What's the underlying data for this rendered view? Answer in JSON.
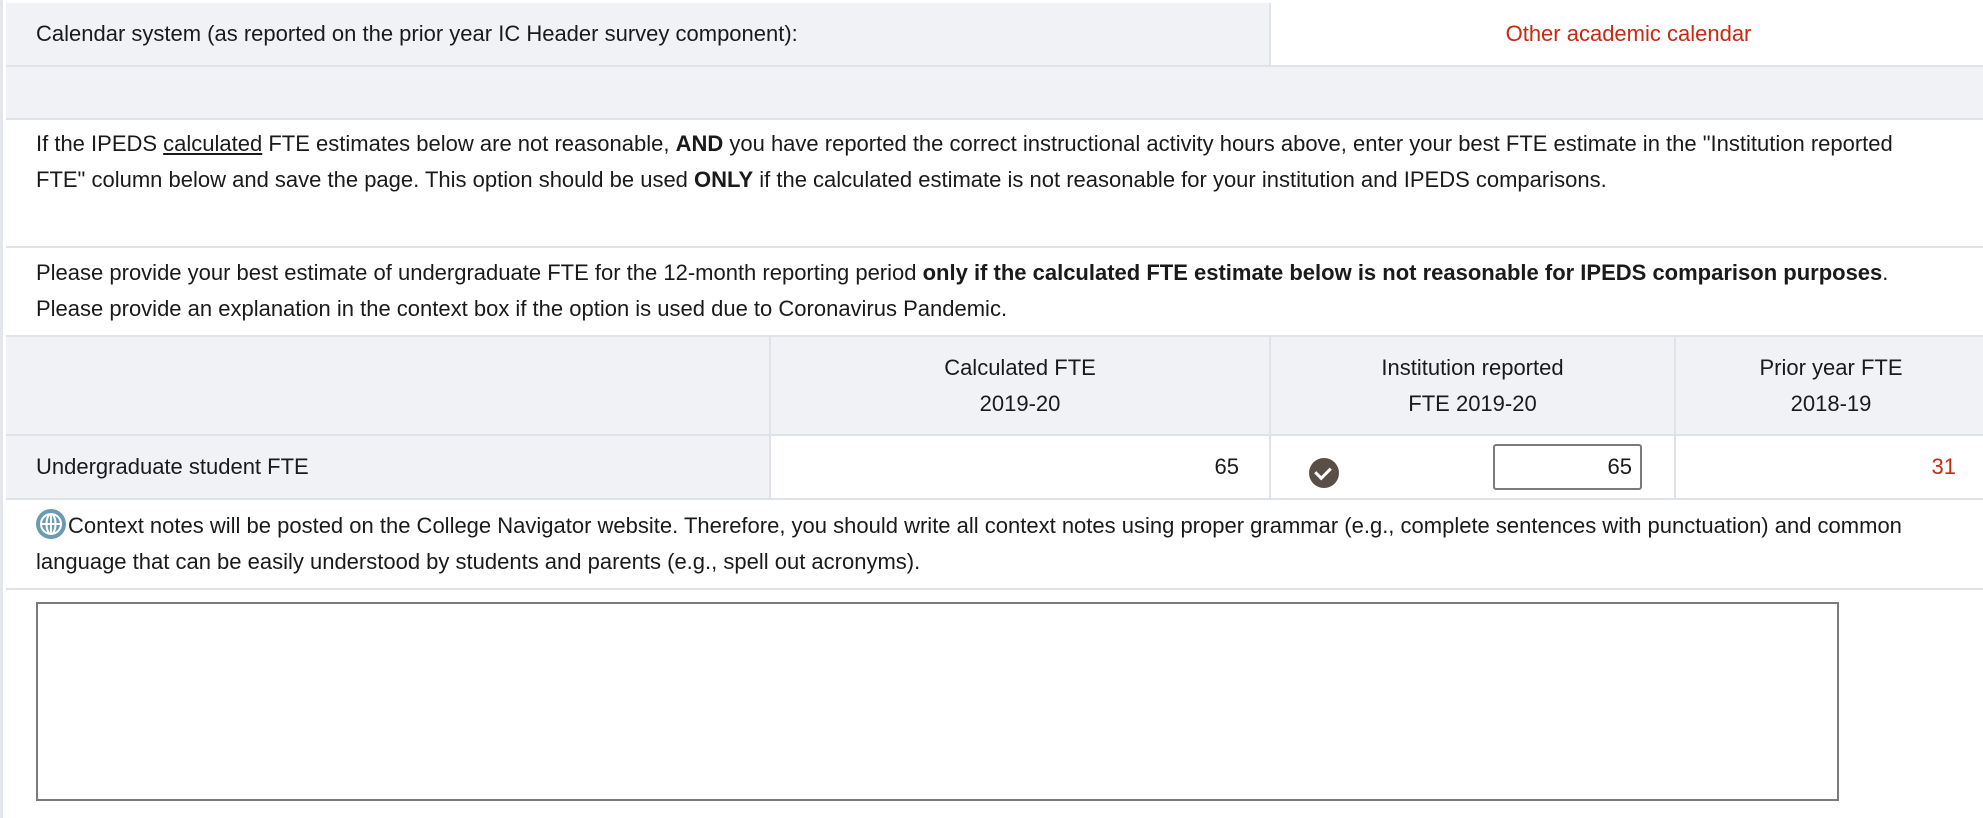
{
  "calendar": {
    "label": "Calendar system (as reported on the prior year IC Header survey component):",
    "value": "Other academic calendar"
  },
  "instructions": {
    "p1": {
      "t1": "If the IPEDS ",
      "calculated": "calculated",
      "t2": " FTE estimates below are not reasonable, ",
      "and": "AND",
      "t3": " you have reported the correct instructional activity hours above, enter your best FTE estimate in the \"Institution reported FTE\" column below and save the page. This option should be used ",
      "only": "ONLY",
      "t4": " if the calculated estimate is not reasonable for your institution and IPEDS comparisons."
    },
    "p2": {
      "t1": "Please provide your best estimate of undergraduate FTE for the 12-month reporting period ",
      "bold": "only if the calculated FTE estimate below is not reasonable for IPEDS comparison purposes",
      "t2": ". Please provide an explanation in the context box if the option is used due to Coronavirus Pandemic."
    }
  },
  "table": {
    "headers": {
      "calculated": [
        "Calculated FTE",
        "2019-20"
      ],
      "institution": [
        "Institution reported",
        "FTE 2019-20"
      ],
      "prior": [
        "Prior year FTE",
        "2018-19"
      ]
    },
    "row": {
      "label": "Undergraduate student FTE",
      "calculated": "65",
      "institution_input": "65",
      "prior": "31"
    }
  },
  "context_note": "Context notes will be posted on the College Navigator website. Therefore, you should write all context notes using proper grammar (e.g., complete sentences with punctuation) and common language that can be easily understood by students and parents (e.g., spell out acronyms).",
  "context_box": {
    "value": ""
  },
  "icons": {
    "status": "check-circle-icon",
    "context": "globe-icon"
  },
  "colors": {
    "accent_red": "#c8290f",
    "header_bg": "#f0f2f6",
    "border": "#dfe3e8"
  }
}
